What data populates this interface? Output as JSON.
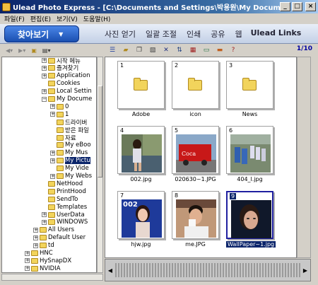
{
  "window": {
    "title": "Ulead Photo Express - [C:\\Documents and Settings\\박용원\\My Documents\\My ...",
    "min": "_",
    "max": "□",
    "close": "×"
  },
  "menu": [
    "파일(F)",
    "편집(E)",
    "보기(V)",
    "도움말(H)"
  ],
  "mode": {
    "browse_label": "찾아보기",
    "tabs": [
      "사진 얻기",
      "일괄 조절",
      "인쇄",
      "공유",
      "웹"
    ],
    "link": "Ulead Links"
  },
  "page_count": "1/10",
  "tree": [
    {
      "label": "시작 메뉴",
      "depth": 2,
      "exp": "+"
    },
    {
      "label": "즐겨찾기",
      "depth": 2,
      "exp": "+"
    },
    {
      "label": "Application",
      "depth": 2,
      "exp": "+"
    },
    {
      "label": "Cookies",
      "depth": 2,
      "exp": ""
    },
    {
      "label": "Local Settin",
      "depth": 2,
      "exp": "+"
    },
    {
      "label": "My Docume",
      "depth": 2,
      "exp": "−"
    },
    {
      "label": "0",
      "depth": 3,
      "exp": "+"
    },
    {
      "label": "1",
      "depth": 3,
      "exp": "+"
    },
    {
      "label": "드라이버",
      "depth": 3,
      "exp": ""
    },
    {
      "label": "받은 파일",
      "depth": 3,
      "exp": ""
    },
    {
      "label": "자료",
      "depth": 3,
      "exp": ""
    },
    {
      "label": "My eBoo",
      "depth": 3,
      "exp": ""
    },
    {
      "label": "My Mus",
      "depth": 3,
      "exp": "+"
    },
    {
      "label": "My Pictu",
      "depth": 3,
      "exp": "+",
      "selected": true
    },
    {
      "label": "My Vide",
      "depth": 3,
      "exp": ""
    },
    {
      "label": "My Webs",
      "depth": 3,
      "exp": "+"
    },
    {
      "label": "NetHood",
      "depth": 2,
      "exp": ""
    },
    {
      "label": "PrintHood",
      "depth": 2,
      "exp": ""
    },
    {
      "label": "SendTo",
      "depth": 2,
      "exp": ""
    },
    {
      "label": "Templates",
      "depth": 2,
      "exp": ""
    },
    {
      "label": "UserData",
      "depth": 2,
      "exp": "+"
    },
    {
      "label": "WINDOWS",
      "depth": 2,
      "exp": "+"
    },
    {
      "label": "All Users",
      "depth": 1,
      "exp": "+"
    },
    {
      "label": "Default User",
      "depth": 1,
      "exp": "+"
    },
    {
      "label": "td",
      "depth": 1,
      "exp": "+"
    },
    {
      "label": "HNC",
      "depth": 0,
      "exp": "+"
    },
    {
      "label": "HySnapDX",
      "depth": 0,
      "exp": "+"
    },
    {
      "label": "NVIDIA",
      "depth": 0,
      "exp": "+"
    }
  ],
  "thumbnails": [
    {
      "num": "1",
      "caption": "Adobe",
      "kind": "folder"
    },
    {
      "num": "2",
      "caption": "icon",
      "kind": "folder"
    },
    {
      "num": "3",
      "caption": "News",
      "kind": "folder"
    },
    {
      "num": "4",
      "caption": "002.jpg",
      "kind": "photo",
      "photo": "girl-by-water"
    },
    {
      "num": "5",
      "caption": "020630~1.JPG",
      "kind": "photo",
      "photo": "coca-cola-truck"
    },
    {
      "num": "6",
      "caption": "404_l.jpg",
      "kind": "photo",
      "photo": "parked-buses"
    },
    {
      "num": "7",
      "caption": "hjw.jpg",
      "kind": "photo",
      "photo": "woman-portrait-blue"
    },
    {
      "num": "8",
      "caption": "me.JPG",
      "kind": "photo",
      "photo": "man-drinking"
    },
    {
      "num": "9",
      "caption": "WallPaper~1.jpg",
      "kind": "photo",
      "photo": "woman-face-dark",
      "selected": true
    }
  ],
  "colors": {
    "title_start": "#0a246a",
    "selection": "#0a246a",
    "accent": "#1a4fb0"
  }
}
